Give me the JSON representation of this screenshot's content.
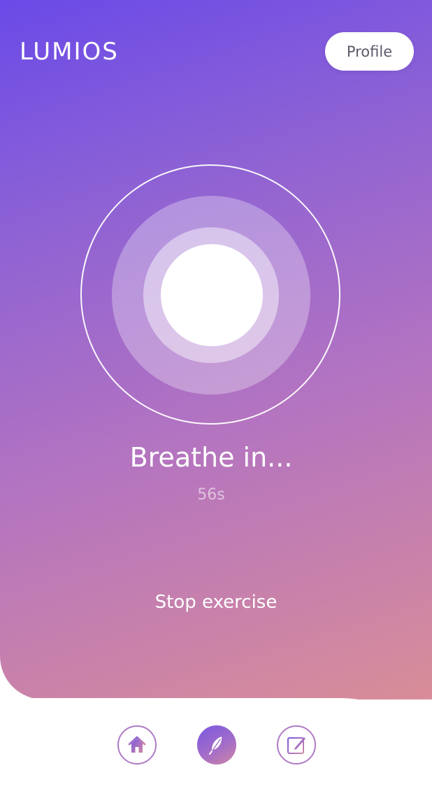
{
  "app": {
    "brand": "LUMIOS"
  },
  "header": {
    "profile_label": "Profile"
  },
  "exercise": {
    "prompt": "Breathe in...",
    "timer": "56s",
    "stop_label": "Stop exercise"
  },
  "nav": {
    "items": [
      {
        "icon": "home-icon",
        "active": false
      },
      {
        "icon": "feather-icon",
        "active": true
      },
      {
        "icon": "journal-icon",
        "active": false
      }
    ]
  },
  "colors": {
    "gradient_start": "#6a4ae8",
    "gradient_mid": "#b474c0",
    "gradient_end": "#d98d98",
    "accent": "#b07ac6",
    "text_on_accent": "#ffffff"
  }
}
